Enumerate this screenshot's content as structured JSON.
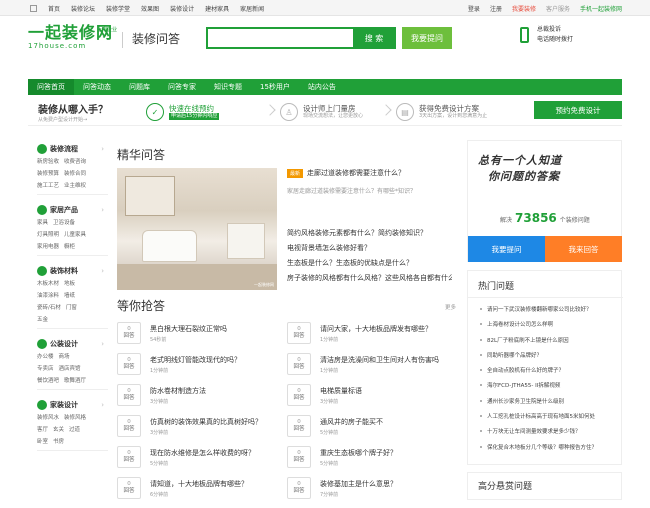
{
  "topbar": {
    "links": [
      "首页",
      "装修论坛",
      "装修学堂",
      "效果图",
      "装修设计",
      "建材家具",
      "家居新闻"
    ],
    "login": "登录",
    "register": "注册",
    "company_join": "我要装修",
    "service": "客户服务",
    "mobile": "手机一起装修网"
  },
  "header": {
    "logo_main": "一起装修网",
    "logo_url": "17house.com",
    "logo_tag": "上市企业",
    "page_name": "装修问答",
    "search_placeholder": "",
    "search_button": "搜 索",
    "ask_button": "我要提问",
    "hotline_line1": "总裁投诉",
    "hotline_line2": "电话随时拨打"
  },
  "nav": [
    "问答首页",
    "问答动态",
    "问题库",
    "问答专家",
    "知识专题",
    "15秒用户",
    "站内公告"
  ],
  "band": {
    "title": "装修从哪入手？",
    "subtitle": "从免费户型设计开始→",
    "steps": [
      {
        "t1": "快速在线预约",
        "t2": "申请后15分钟内响应"
      },
      {
        "t1": "设计师上门量房",
        "t2": "现场交流想法，让您更放心"
      },
      {
        "t1": "获得免费设计方案",
        "t2": "3天出方案，设计到您满意为止"
      }
    ],
    "appt_button": "预约免费设计"
  },
  "sidebar": [
    {
      "title": "装修流程",
      "rows": [
        [
          "新房验收",
          "收费咨询"
        ],
        [
          "装修预算",
          "装修合同"
        ],
        [
          "施工工艺",
          "业主维权"
        ]
      ]
    },
    {
      "title": "家居产品",
      "rows": [
        [
          "家具",
          "卫浴设备"
        ],
        [
          "灯具照明",
          "儿童家具"
        ],
        [
          "家用电器",
          "橱柜"
        ]
      ]
    },
    {
      "title": "装饰材料",
      "rows": [
        [
          "木板木材",
          "地板"
        ],
        [
          "油漆涂料",
          "墙纸"
        ],
        [
          "瓷砖/石材",
          "门窗"
        ],
        [
          "五金"
        ]
      ]
    },
    {
      "title": "公装设计",
      "rows": [
        [
          "办公楼",
          "商场"
        ],
        [
          "专卖店",
          "酒店宾馆"
        ],
        [
          "餐饮酒吧",
          "歌舞酒厅"
        ]
      ]
    },
    {
      "title": "家装设计",
      "rows": [
        [
          "装修风水",
          "装修风格"
        ],
        [
          "客厅",
          "玄关",
          "过道"
        ],
        [
          "卧室",
          "书房"
        ]
      ]
    }
  ],
  "featured": {
    "title": "精华问答",
    "image_caption": "一起装修网",
    "badge": "最新",
    "top_question": "走廊过道装修都需要注意什么？",
    "top_desc": "家居走廊过道装修需要注意什么？有哪些*知识？",
    "questions": [
      "简约风格装修元素都有什么？简约装修知识？",
      "电视背景墙怎么装修好看？",
      "生态板是什么？生态板的优缺点是什么？",
      "房子装修的风格都有什么风格？这些风格各自都有什么特点？"
    ]
  },
  "waiting": {
    "title": "等你抢答",
    "more": "更多",
    "answer_label": "回答",
    "left": [
      {
        "q": "黑白根大理石裂纹正常吗",
        "n": "0",
        "t": "54秒前"
      },
      {
        "q": "老式明线灯管能改现代的吗？",
        "n": "0",
        "t": "1分钟前"
      },
      {
        "q": "防水卷材制造方法",
        "n": "0",
        "t": "3分钟前"
      },
      {
        "q": "仿真树的装饰效果真的比真树好吗？",
        "n": "0",
        "t": "3分钟前"
      },
      {
        "q": "现在防水维修是怎么样收费的呀？",
        "n": "0",
        "t": "5分钟前"
      },
      {
        "q": "请知道，十大地板品牌有哪些？",
        "n": "0",
        "t": "6分钟前"
      }
    ],
    "right": [
      {
        "q": "请问大家，十大地板品牌发有哪些？",
        "n": "0",
        "t": "1分钟前"
      },
      {
        "q": "清洁房是洗澡间和卫生间对人有伤害吗",
        "n": "0",
        "t": "1分钟前"
      },
      {
        "q": "电梯质量标语",
        "n": "0",
        "t": "3分钟前"
      },
      {
        "q": "通风井的房子能买不",
        "n": "0",
        "t": "5分钟前"
      },
      {
        "q": "重庆生态板哪个牌子好？",
        "n": "0",
        "t": "5分钟前"
      },
      {
        "q": "装修基加主是什么意思？",
        "n": "0",
        "t": "7分钟前"
      }
    ]
  },
  "promo": {
    "slogan_line1": "总有一个人知道",
    "slogan_line2": "你问题的答案",
    "solved_prefix": "解决",
    "solved_count": "73856",
    "solved_suffix": "个装修问题",
    "ask": "我要提问",
    "answer": "我来回答"
  },
  "hot": {
    "title": "热门问题",
    "items": [
      "请问一下武汉装修楼翻新哪家公司比较好？",
      "上海卷材设计公司怎么样啊",
      "82L厂子粉底刷不上镜是什么原因",
      "同助听器哪个品牌好？",
      "全自动点胶机有什么好的牌子？",
      "海尔FCD-JTHA55- II拆解视频",
      "通州长沙家务卫生院是什么级别",
      "人工挖孔桩设计标高高于现有地面5米如何处",
      "十万块无让车间测量效要求是多少钱？",
      "保化复合木地板分几个等级？哪种报告方住？"
    ]
  },
  "hot2": {
    "title": "高分悬赏问题"
  }
}
